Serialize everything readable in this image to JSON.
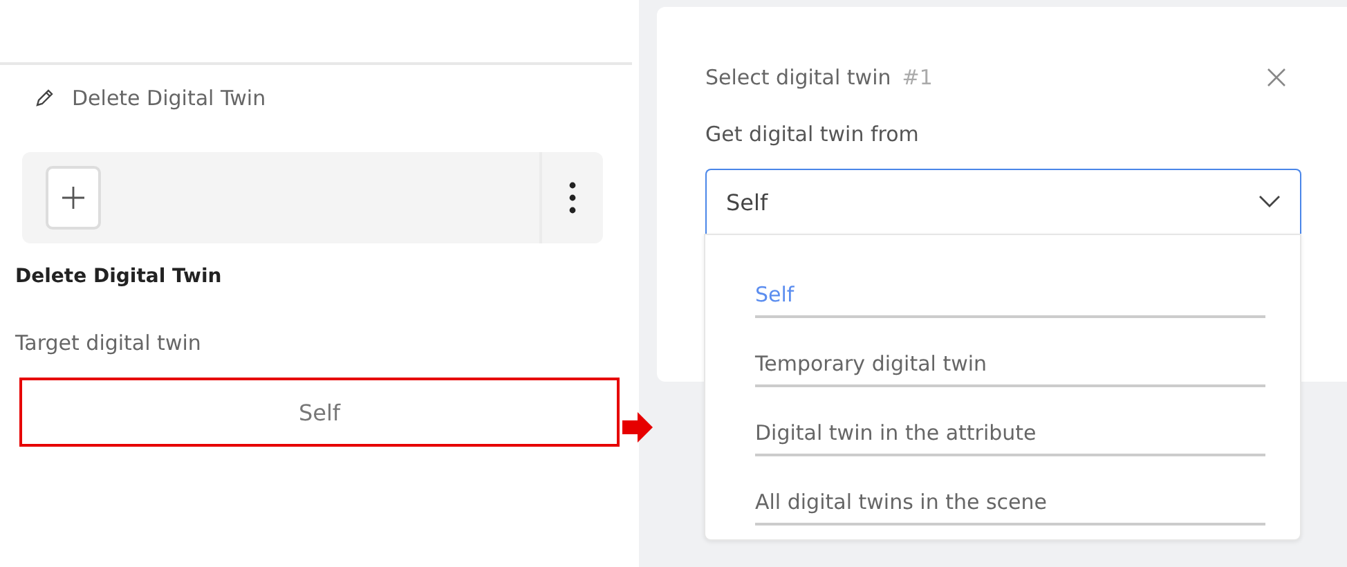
{
  "step": {
    "title": "Delete Digital Twin"
  },
  "section": {
    "heading": "Delete Digital Twin",
    "field_label": "Target digital twin",
    "field_value": "Self"
  },
  "dialog": {
    "title": "Select digital twin",
    "number": "#1",
    "label": "Get digital twin from",
    "value": "Self",
    "expanded": true,
    "options": [
      {
        "label": "Self",
        "selected": true
      },
      {
        "label": "Temporary digital twin",
        "selected": false
      },
      {
        "label": "Digital twin in the attribute",
        "selected": false
      },
      {
        "label": "All digital twins in the scene",
        "selected": false
      }
    ]
  }
}
